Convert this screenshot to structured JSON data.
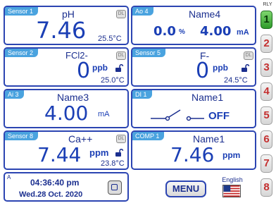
{
  "tiles": {
    "t1": {
      "tab": "Sensor 1",
      "name": "pH",
      "value": "7.46",
      "temp": "25.5°C",
      "dl_icon": "DL"
    },
    "t2": {
      "tab": "Ao 4",
      "name": "Name4",
      "percent": "0.0",
      "percent_unit": "%",
      "value": "4.00",
      "unit": "mA"
    },
    "t3": {
      "tab": "Sensor 2",
      "name": "FCl2-",
      "value": "0",
      "unit": "ppb",
      "temp": "25.0°C",
      "dl_icon": "DL"
    },
    "t4": {
      "tab": "Sensor 5",
      "name": "F-",
      "value": "0",
      "unit": "ppb",
      "temp": "24.5°C",
      "dl_icon": "DL"
    },
    "t5": {
      "tab": "Ai 3",
      "name": "Name3",
      "value": "4.00",
      "unit": "mA"
    },
    "t6": {
      "tab": "DI 1",
      "name": "Name1",
      "state": "OFF"
    },
    "t7": {
      "tab": "Sensor 8",
      "name": "Ca++",
      "value": "7.44",
      "unit": "ppm",
      "temp": "23.8°C",
      "dl_icon": "DL"
    },
    "t8": {
      "tab": "COMP 1",
      "name": "Name1",
      "value": "7.46",
      "unit": "ppm"
    }
  },
  "clock": {
    "corner": "A",
    "time": "04:36:40 pm",
    "date": "Wed.28 Oct. 2020"
  },
  "menu_label": "MENU",
  "language": "English",
  "relays": {
    "title": "RLY",
    "items": [
      {
        "label": "1",
        "state": "on"
      },
      {
        "label": "2",
        "state": "off"
      },
      {
        "label": "3",
        "state": "off"
      },
      {
        "label": "4",
        "state": "off"
      },
      {
        "label": "5",
        "state": "off"
      },
      {
        "label": "6",
        "state": "off"
      },
      {
        "label": "7",
        "state": "off"
      },
      {
        "label": "8",
        "state": "off"
      }
    ]
  },
  "colors": {
    "border": "#2c45b2",
    "tab": "#4aa3df",
    "value": "#1b3fb5",
    "relay_on": "#2e9a2a",
    "relay_text": "#c43030"
  },
  "icons": [
    "datalog-icon",
    "unlock-icon",
    "switch-open-icon",
    "stop-button-icon",
    "us-flag-icon"
  ]
}
